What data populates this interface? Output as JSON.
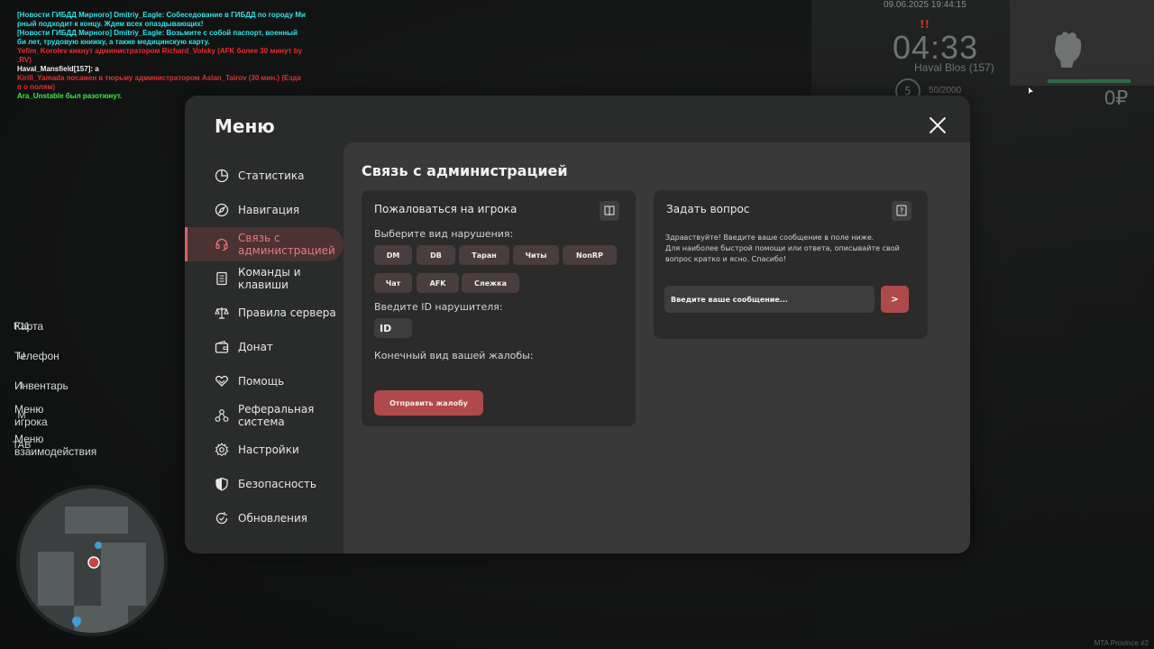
{
  "chat": [
    {
      "color": "cyan",
      "text": "[Новости ГИБДД Мирного] Dmitriy_Eagle: Собеседование в ГИБДД по городу Ми рный подходит к концу. Ждем всех опаздывающих!"
    },
    {
      "color": "cyan",
      "text": "[Новости ГИБДД Мирного] Dmitriy_Eagle: Возьмите с собой паспорт, военный би лет, трудовую книжку, а также медицинскую карту."
    },
    {
      "color": "red",
      "text": "Yefim_Korolev кикнут администратором Richard_Volsky (AFK более 30 минут by .RV)"
    },
    {
      "color": "white",
      "text": "Haval_Mansfield[157]: а"
    },
    {
      "color": "red",
      "text": "Kirill_Yamada посажен в тюрьму администратором Aslan_Tairov (30 мин.) (Езда п о полям)"
    },
    {
      "color": "green",
      "text": "Ara_Unstable был разотюнут."
    }
  ],
  "hud": {
    "date": "09.06.2025 19:44:15",
    "warn": "!!",
    "time": "04:33",
    "player": "Haval Blos (157)",
    "level": "5",
    "xp": "50/2000",
    "money": "0₽",
    "health_fraction": 1.0
  },
  "keybinds": [
    {
      "key": "F11",
      "label": "Карта"
    },
    {
      "key": "U",
      "label": "Телефон"
    },
    {
      "key": "I",
      "label": "Инвентарь"
    },
    {
      "key": "M",
      "label": "Меню игрока"
    },
    {
      "key": "TAB",
      "label": "Меню взаимодействия"
    }
  ],
  "watermark": "MTA Province #2",
  "menu": {
    "title": "Меню",
    "sidebar": [
      {
        "icon": "pie-chart-icon",
        "label": "Статистика"
      },
      {
        "icon": "compass-icon",
        "label": "Навигация"
      },
      {
        "icon": "headset-icon",
        "label": "Связь с администрацией",
        "active": true
      },
      {
        "icon": "document-icon",
        "label": "Команды и клавиши"
      },
      {
        "icon": "scales-icon",
        "label": "Правила сервера"
      },
      {
        "icon": "wallet-icon",
        "label": "Донат"
      },
      {
        "icon": "heart-hands-icon",
        "label": "Помощь"
      },
      {
        "icon": "network-icon",
        "label": "Реферальная система"
      },
      {
        "icon": "gear-icon",
        "label": "Настройки"
      },
      {
        "icon": "shield-icon",
        "label": "Безопасность"
      },
      {
        "icon": "refresh-check-icon",
        "label": "Обновления"
      }
    ],
    "content_title": "Связь с администрацией",
    "report": {
      "title": "Пожаловаться на игрока",
      "violation_label": "Выберите вид нарушения:",
      "violations_row1": [
        "DM",
        "DB",
        "Таран",
        "Читы",
        "NonRP"
      ],
      "violations_row2": [
        "Чат",
        "AFK",
        "Слежка"
      ],
      "id_label": "Введите ID нарушителя:",
      "id_value": "ID",
      "final_label": "Конечный вид вашей жалобы:",
      "submit": "Отправить жалобу"
    },
    "question": {
      "title": "Задать вопрос",
      "line1": "Здравствуйте! Введите ваше сообщение в поле ниже.",
      "line2": "Для наиболее быстрой помощи или ответа, описывайте свой вопрос кратко и ясно. Спасибо!",
      "placeholder": "Введите ваше сообщение...",
      "send": ">"
    }
  },
  "colors": {
    "accent": "#b04a4a",
    "active_text": "#e77b7b",
    "chat_cyan": "#35e1e6",
    "chat_red": "#e23030",
    "chat_green": "#3bf03b"
  }
}
